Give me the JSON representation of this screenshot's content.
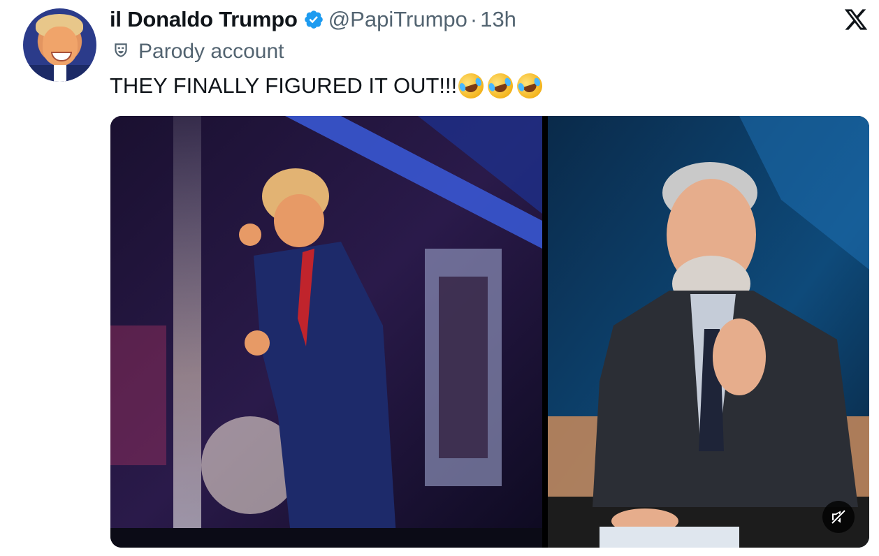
{
  "author": {
    "display_name": "il Donaldo Trumpo",
    "handle": "@PapiTrumpo",
    "separator": "·",
    "time": "13h",
    "label": "Parody account"
  },
  "tweet": {
    "text": "THEY FINALLY FIGURED IT OUT!!!",
    "emojis": [
      "rolling-on-floor-laughing",
      "rolling-on-floor-laughing",
      "rolling-on-floor-laughing"
    ]
  },
  "icons": {
    "verified": "verified-badge-icon",
    "parody": "parody-mask-icon",
    "brand": "x-logo-icon",
    "mute": "muted-speaker-icon"
  },
  "colors": {
    "text_primary": "#0f1419",
    "text_secondary": "#536471",
    "verified_blue": "#1d9bf0"
  }
}
